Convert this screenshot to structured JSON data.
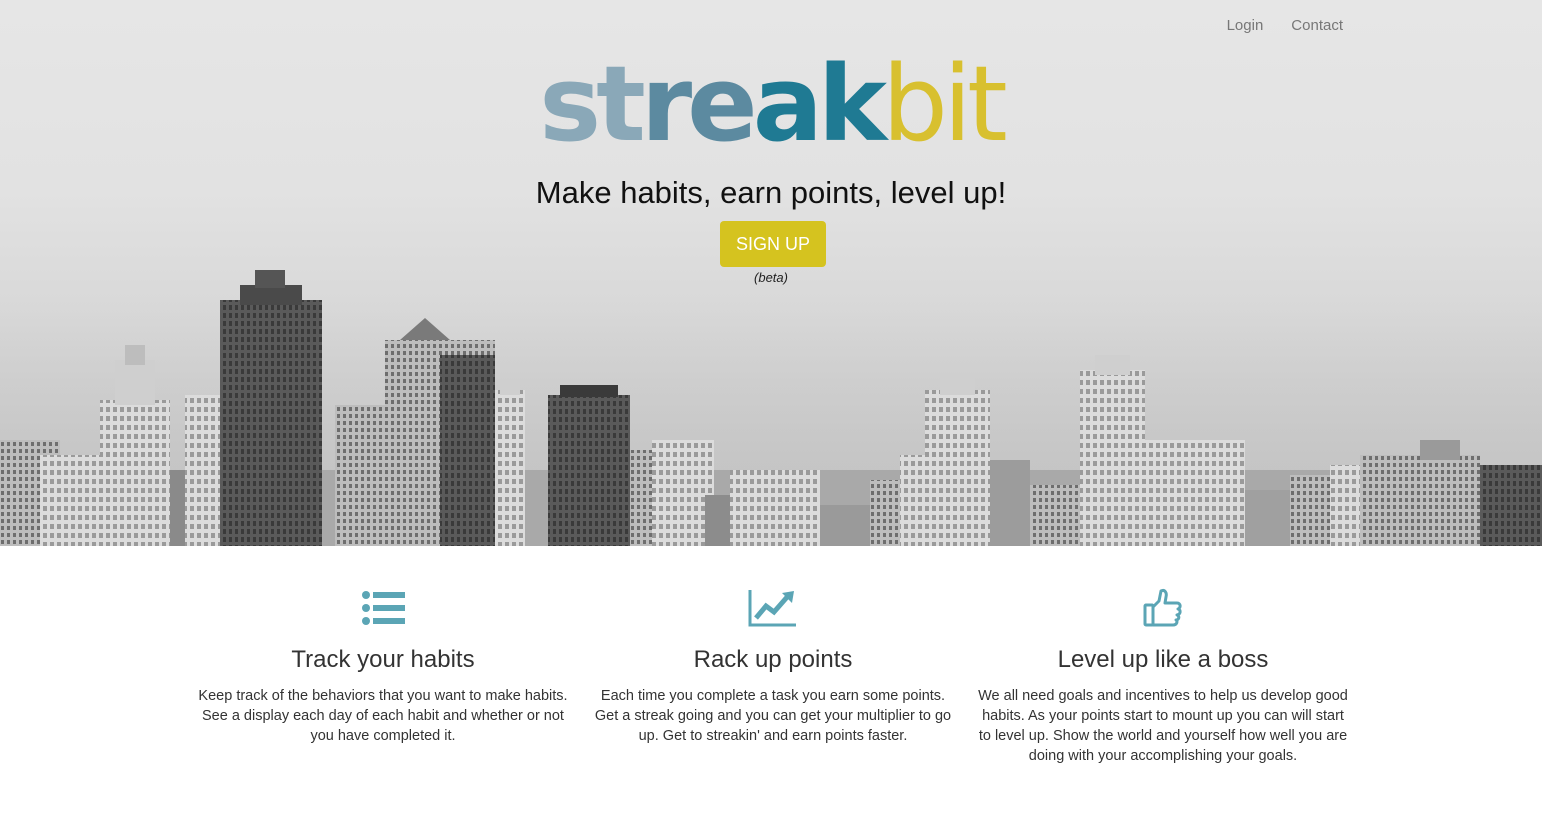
{
  "nav": {
    "login": "Login",
    "contact": "Contact"
  },
  "logo": {
    "part1": "streak",
    "part2": "bit"
  },
  "hero": {
    "tagline": "Make habits, earn points, level up!",
    "signup_label": "SIGN UP",
    "beta_note": "(beta)"
  },
  "features": [
    {
      "icon": "list-icon",
      "title": "Track your habits",
      "text": "Keep track of the behaviors that you want to make habits. See a display each day of each habit and whether or not you have completed it."
    },
    {
      "icon": "line-chart-icon",
      "title": "Rack up points",
      "text": "Each time you complete a task you earn some points. Get a streak going and you can get your multiplier to go up. Get to streakin' and earn points faster."
    },
    {
      "icon": "thumbs-up-icon",
      "title": "Level up like a boss",
      "text": "We all need goals and incentives to help us develop good habits. As your points start to mount up you can will start to level up. Show the world and yourself how well you are doing with your accomplishing your goals."
    }
  ],
  "colors": {
    "logo_blue_light": "#8aa8b8",
    "logo_blue_mid": "#5c8aa0",
    "logo_blue_dark": "#1f7a93",
    "logo_yellow": "#d8c02f",
    "button": "#d5c31f",
    "icon": "#5ba5b5"
  }
}
